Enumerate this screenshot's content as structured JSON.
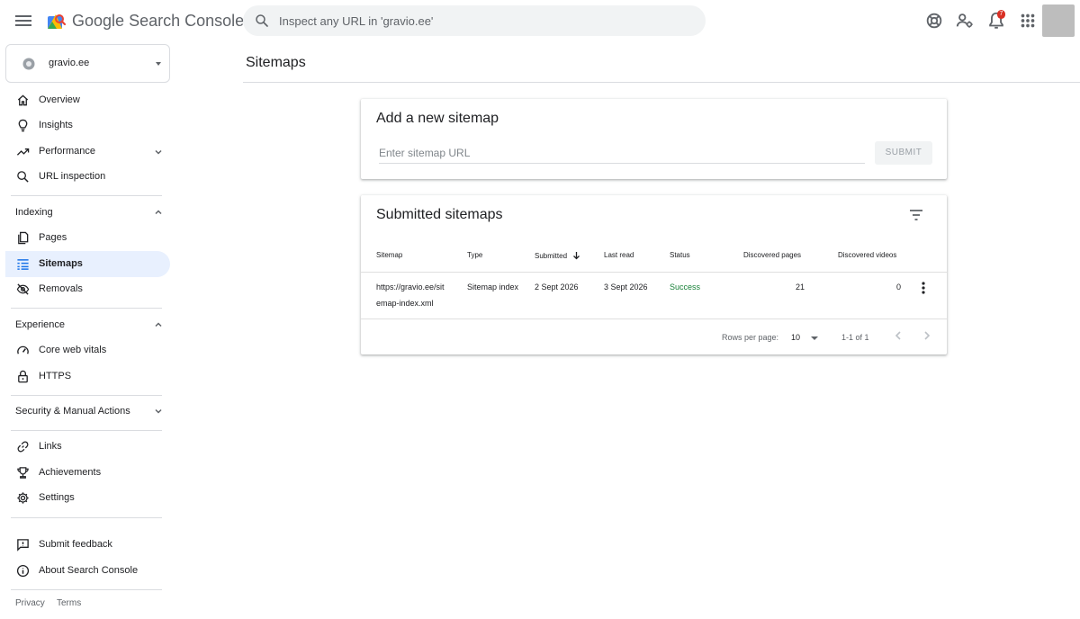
{
  "header": {
    "brand_part1": "Google",
    "brand_part2": "Search Console",
    "search_placeholder": "Inspect any URL in 'gravio.ee'",
    "notification_count": "7"
  },
  "sidebar": {
    "property": "gravio.ee",
    "top_items": [
      {
        "label": "Overview",
        "icon": "home-icon"
      },
      {
        "label": "Insights",
        "icon": "lightbulb-icon"
      },
      {
        "label": "Performance",
        "icon": "trending-up-icon"
      },
      {
        "label": "URL inspection",
        "icon": "search-icon"
      }
    ],
    "sections": {
      "indexing": {
        "label": "Indexing",
        "items": [
          {
            "label": "Pages",
            "icon": "pages-icon"
          },
          {
            "label": "Sitemaps",
            "icon": "sitemap-icon"
          },
          {
            "label": "Removals",
            "icon": "visibility-off-icon"
          }
        ]
      },
      "experience": {
        "label": "Experience",
        "items": [
          {
            "label": "Core web vitals",
            "icon": "speed-icon"
          },
          {
            "label": "HTTPS",
            "icon": "lock-icon"
          }
        ]
      },
      "security": {
        "label": "Security & Manual Actions"
      }
    },
    "bottom_items": [
      {
        "label": "Links",
        "icon": "link-icon"
      },
      {
        "label": "Achievements",
        "icon": "trophy-icon"
      },
      {
        "label": "Settings",
        "icon": "gear-icon"
      }
    ],
    "footer_items": [
      {
        "label": "Submit feedback",
        "icon": "feedback-icon"
      },
      {
        "label": "About Search Console",
        "icon": "info-icon"
      }
    ],
    "links": {
      "privacy": "Privacy",
      "terms": "Terms"
    },
    "active_item": "Sitemaps"
  },
  "main": {
    "page_title": "Sitemaps",
    "add_card": {
      "title": "Add a new sitemap",
      "input_placeholder": "Enter sitemap URL",
      "submit_label": "SUBMIT"
    },
    "submitted_card": {
      "title": "Submitted sitemaps",
      "columns": {
        "sitemap": "Sitemap",
        "type": "Type",
        "submitted": "Submitted",
        "last_read": "Last read",
        "status": "Status",
        "discovered_pages": "Discovered pages",
        "discovered_videos": "Discovered videos"
      },
      "rows": [
        {
          "sitemap_line1": "https://gravio.ee/sit",
          "sitemap_line2": "emap-index.xml",
          "type": "Sitemap index",
          "submitted": "2 Sept 2026",
          "last_read": "3 Sept 2026",
          "status": "Success",
          "discovered_pages": "21",
          "discovered_videos": "0"
        }
      ],
      "pagination": {
        "rows_per_page_label": "Rows per page:",
        "rows_per_page": "10",
        "range": "1-1 of 1"
      }
    }
  },
  "colors": {
    "active_nav_bg": "#e8f0fe",
    "success": "#188038",
    "text": "#202124",
    "muted": "#5f6368"
  }
}
